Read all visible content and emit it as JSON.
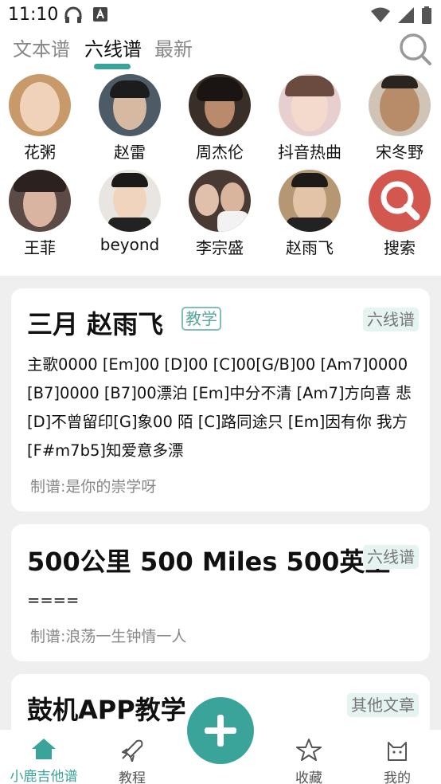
{
  "status_bar": {
    "time": "11:10"
  },
  "tabs": [
    {
      "label": "文本谱"
    },
    {
      "label": "六线谱"
    },
    {
      "label": "最新"
    }
  ],
  "artists": [
    {
      "name": "花粥",
      "color": "#c89a6a"
    },
    {
      "name": "赵雷",
      "color": "#4d5b66"
    },
    {
      "name": "周杰伦",
      "color": "#3a2f28"
    },
    {
      "name": "抖音热曲",
      "color": "#e3b9b9"
    },
    {
      "name": "宋冬野",
      "color": "#8a7460"
    },
    {
      "name": "王菲",
      "color": "#5b4a46"
    },
    {
      "name": "beyond",
      "color": "#d6d2cc"
    },
    {
      "name": "李宗盛",
      "color": "#4a3a34"
    },
    {
      "name": "赵雨飞",
      "color": "#3f3a36"
    },
    {
      "name": "搜索",
      "color": "#d2574f"
    }
  ],
  "cards": [
    {
      "title": "三月 赵雨飞",
      "badge": "教学",
      "category": "六线谱",
      "lines": [
        "主歌0000 [Em]00 [D]00 [C]00[G/B]00 [Am7]0000",
        "[B7]0000 [B7]00漂泊 [Em]中分不清 [Am7]方向喜 悲",
        "[D]不曾留印[G]象00 陌 [C]路同途只 [Em]因有你 我方",
        "[F#m7b5]知爱意多漂"
      ],
      "author": "制谱:是你的崇学呀"
    },
    {
      "title": "500公里 500 Miles 500英里",
      "category": "六线谱",
      "lines": [
        "===="
      ],
      "author": "制谱:浪荡一生钟情一人"
    },
    {
      "title": "鼓机APP教学",
      "category": "其他文章"
    }
  ],
  "bottom_nav": [
    {
      "label": "小鹿吉他谱",
      "icon": "home-icon"
    },
    {
      "label": "教程",
      "icon": "rocket-icon"
    },
    {
      "label": "收藏",
      "icon": "star-icon"
    },
    {
      "label": "我的",
      "icon": "cat-icon"
    }
  ],
  "colors": {
    "accent": "#3aa39a"
  }
}
